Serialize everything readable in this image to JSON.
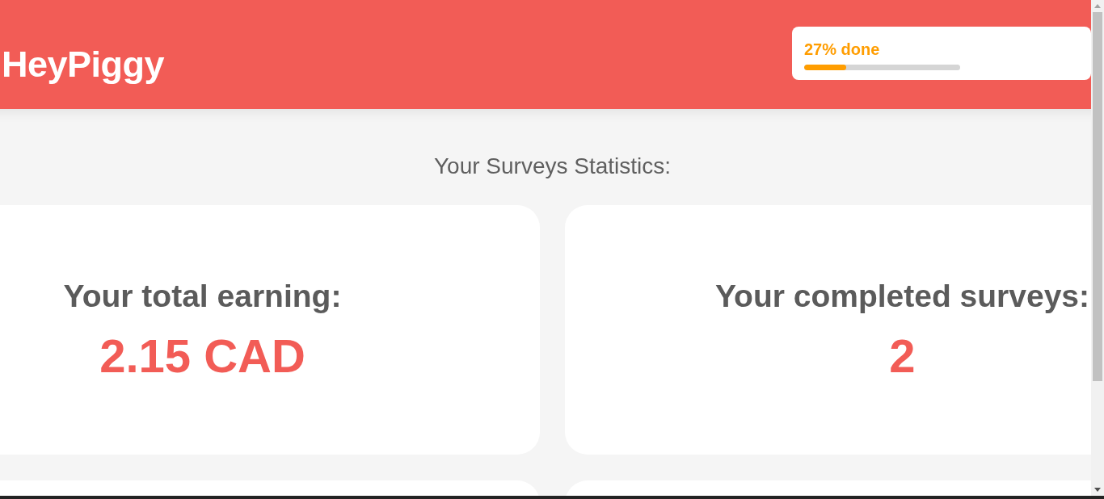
{
  "header": {
    "logo": "HeyPiggy",
    "progress": {
      "label": "27% done",
      "level": 0.27
    }
  },
  "statistics": {
    "title": "Your Surveys Statistics:",
    "cards": [
      {
        "label": "Your total earning:",
        "value": "2.15 CAD"
      },
      {
        "label": "Your completed surveys:",
        "value": "2"
      }
    ]
  }
}
